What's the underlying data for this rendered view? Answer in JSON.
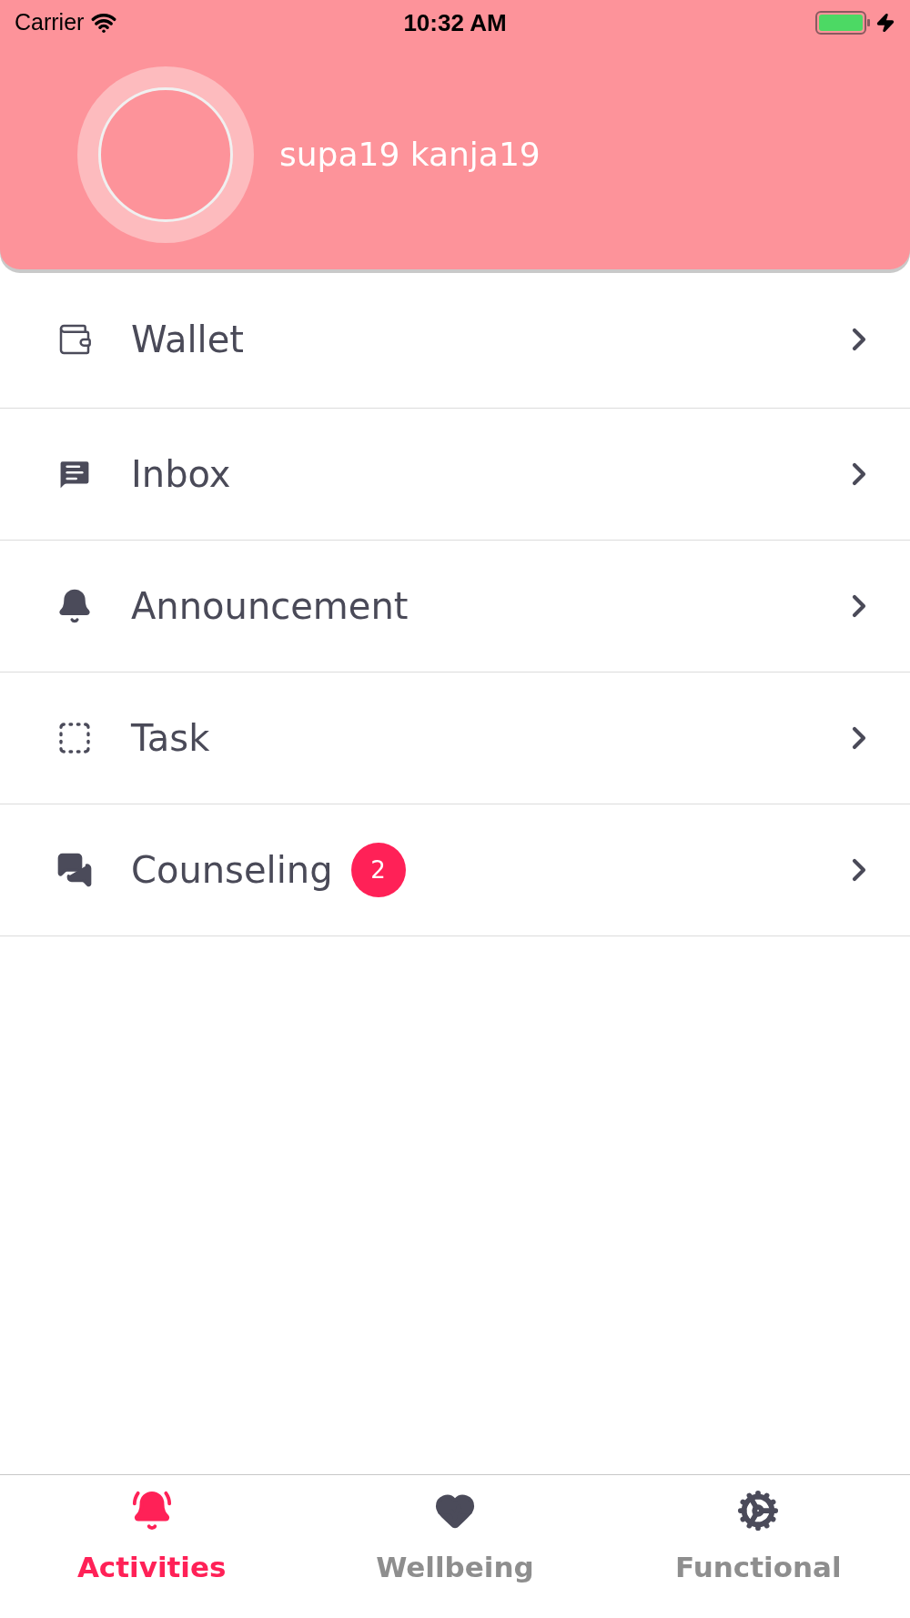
{
  "status_bar": {
    "carrier": "Carrier",
    "time": "10:32 AM"
  },
  "profile": {
    "name": "supa19 kanja19"
  },
  "menu": [
    {
      "kind": "wallet",
      "label": "Wallet"
    },
    {
      "kind": "inbox",
      "label": "Inbox"
    },
    {
      "kind": "announcement",
      "label": "Announcement"
    },
    {
      "kind": "task",
      "label": "Task"
    },
    {
      "kind": "counseling",
      "label": "Counseling",
      "badge": "2"
    }
  ],
  "tabs": [
    {
      "kind": "activities",
      "label": "Activities",
      "selected": true
    },
    {
      "kind": "wellbeing",
      "label": "Wellbeing",
      "selected": false
    },
    {
      "kind": "functional",
      "label": "Functional",
      "selected": false
    }
  ]
}
